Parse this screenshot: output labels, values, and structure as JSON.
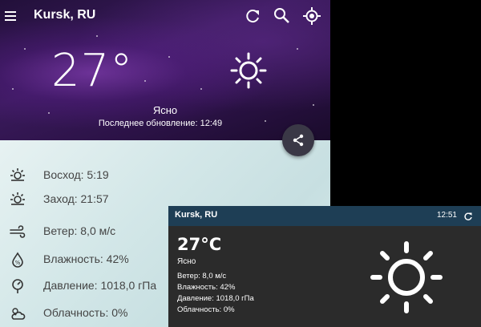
{
  "app": {
    "city": "Kursk, RU",
    "temperature": "27°",
    "description": "Ясно",
    "last_update": "Последнее обновление: 12:49",
    "icons": {
      "menu": "menu-icon",
      "refresh": "refresh-icon",
      "search": "search-icon",
      "location": "my-location-icon",
      "weather": "clear-sun-icon",
      "share": "share-icon"
    },
    "details": [
      {
        "icon": "sunrise-icon",
        "text": "Восход: 5:19"
      },
      {
        "icon": "sunset-icon",
        "text": "Заход: 21:57"
      },
      {
        "icon": "wind-icon",
        "text": "Ветер: 8,0 м/с"
      },
      {
        "icon": "humidity-icon",
        "text": "Влажность: 42%"
      },
      {
        "icon": "pressure-icon",
        "text": "Давление: 1018,0 гПа"
      },
      {
        "icon": "cloudiness-icon",
        "text": "Облачность: 0%"
      }
    ]
  },
  "widget": {
    "city": "Kursk, RU",
    "time": "12:51",
    "temperature": "27°C",
    "description": "Ясно",
    "lines": [
      "Ветер: 8,0 м/с",
      "Влажность: 42%",
      "Давление: 1018,0 гПа",
      "Облачность: 0%"
    ]
  },
  "colors": {
    "header_purple": "#3a1a5c",
    "details_bg": "#d3e7e8",
    "widget_bar": "#1e3e55",
    "widget_bg": "#2b2b2b"
  }
}
